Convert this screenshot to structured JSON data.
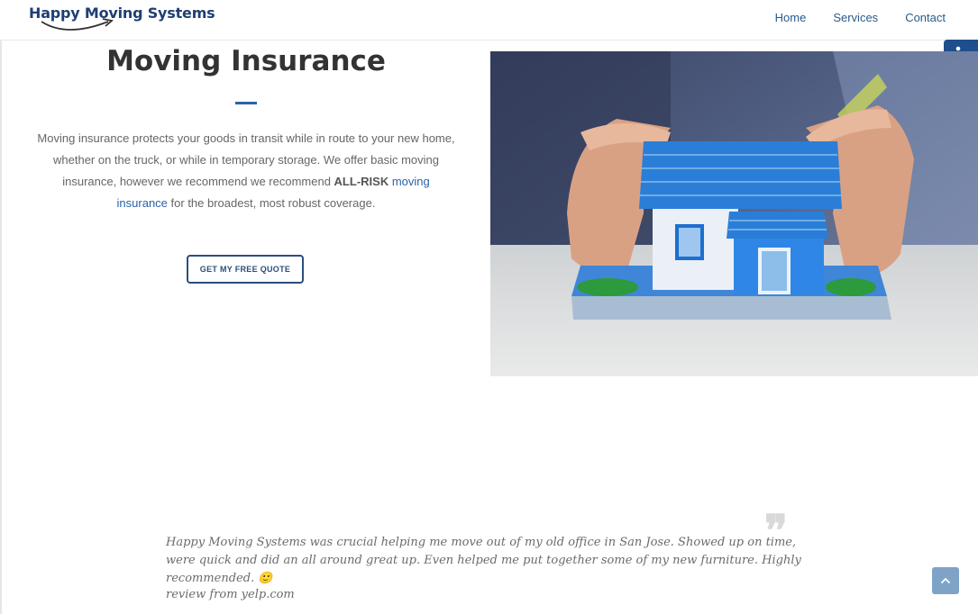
{
  "header": {
    "logo_text": "Happy Moving Systems",
    "nav": [
      "Home",
      "Services",
      "Contact"
    ]
  },
  "hero": {
    "title": "Moving Insurance",
    "body_part1": "Moving insurance protects your goods in transit while in route to your new home, whether on the truck, or while in temporary storage. We offer basic moving insurance, however we recommend  we recommend ",
    "body_bold": "ALL-RISK",
    "body_link": "moving insurance",
    "body_part2": " for the broadest, most robust coverage.",
    "cta_label": "GET MY FREE QUOTE"
  },
  "testimonial": {
    "text": "Happy Moving Systems was crucial helping me move out of my old office in San Jose. Showed up on time, were quick and did an all around great up. Even helped me put together some of my new furniture. Highly recommended. 🙂",
    "source": "review from yelp.com"
  },
  "icons": {
    "accessibility": "wheelchair-icon",
    "scroll_top": "chevron-up-icon",
    "quote": "quote-icon"
  },
  "colors": {
    "brand": "#1f4e8c",
    "accent": "#2a63a8"
  }
}
